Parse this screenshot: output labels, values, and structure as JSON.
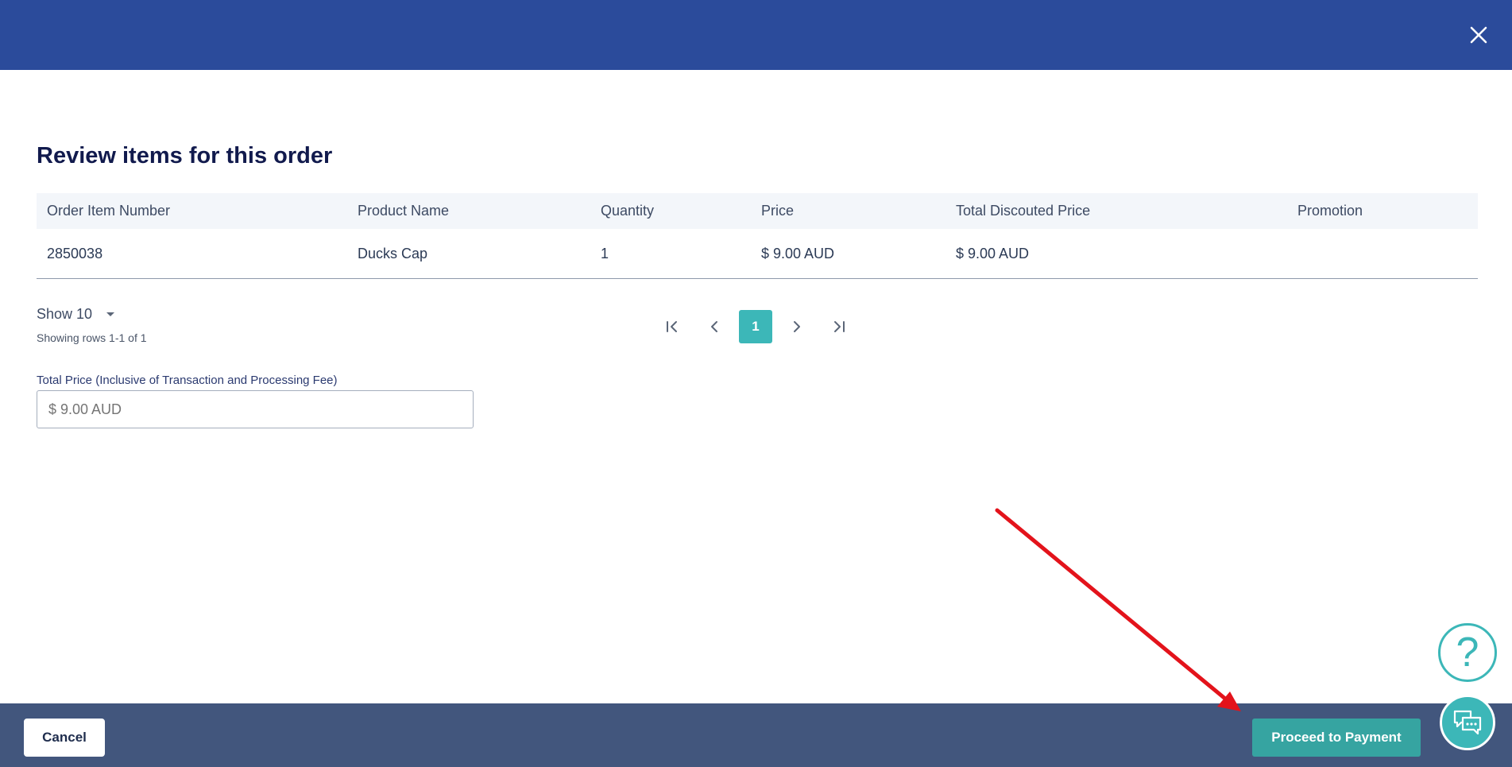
{
  "modal": {
    "title": "Review items for this order",
    "close_icon": "close-icon"
  },
  "table": {
    "headers": [
      "Order Item Number",
      "Product Name",
      "Quantity",
      "Price",
      "Total Discouted Price",
      "Promotion"
    ],
    "rows": [
      [
        "2850038",
        "Ducks Cap",
        "1",
        "$ 9.00 AUD",
        "$ 9.00 AUD",
        ""
      ]
    ]
  },
  "pagination": {
    "show_label": "Show 10",
    "rows_info": "Showing rows 1-1 of 1",
    "current_page": "1"
  },
  "total_price": {
    "label": "Total Price (Inclusive of Transaction and Processing Fee)",
    "placeholder": "$ 9.00 AUD"
  },
  "footer": {
    "cancel_label": "Cancel",
    "proceed_label": "Proceed to Payment"
  },
  "help": {
    "help_glyph": "?"
  },
  "colors": {
    "header_bar": "#2b4b9b",
    "footer_bar": "#42567d",
    "accent": "#3cb7b8",
    "proceed_button": "#36a4a1",
    "annotation_arrow": "#e3131b"
  }
}
